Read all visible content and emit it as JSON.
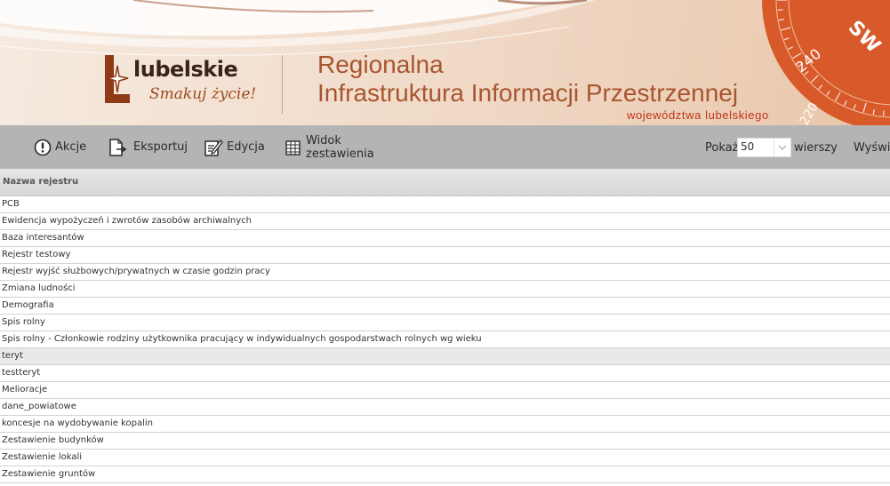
{
  "banner": {
    "logo_word": "lubelskie",
    "logo_slogan": "Smakuj życie!",
    "title_line1": "Regionalna",
    "title_line2": "Infrastruktura Informacji Przestrzennej",
    "subtitle": "województwa lubelskiego",
    "compass_labels": [
      "240",
      "SW",
      "220"
    ]
  },
  "toolbar": {
    "buttons": [
      {
        "label": "Akcje",
        "icon": "exclamation-circle-icon"
      },
      {
        "label": "Eksportuj",
        "icon": "export-document-icon"
      },
      {
        "label": "Edycja",
        "icon": "edit-note-icon"
      },
      {
        "label": "Widok\nzestawienia",
        "icon": "grid-table-icon"
      }
    ],
    "show_label": "Pokaż",
    "rows_per_page": "50",
    "rows_label": "wierszy",
    "view_label": "Wyświe"
  },
  "table": {
    "column_header": "Nazwa rejestru",
    "selected_row": "teryt",
    "rows": [
      "PCB",
      "Ewidencja wypożyczeń i zwrotów zasobów archiwalnych",
      "Baza interesantów",
      "Rejestr testowy",
      "Rejestr wyjść służbowych/prywatnych w czasie godzin pracy",
      "Zmiana ludności",
      "Demografia",
      "Spis rolny",
      "Spis rolny - Członkowie rodziny użytkownika pracujący w indywidualnych gospodarstwach rolnych wg wieku",
      "teryt",
      "testteryt",
      "Melioracje",
      "dane_powiatowe",
      "koncesje na wydobywanie kopalin",
      "Zestawienie budynków",
      "Zestawienie lokali",
      "Zestawienie gruntów"
    ]
  },
  "colors": {
    "accent_orange": "#c0321a",
    "title_brown": "#a8552f",
    "toolbar_gray": "#b4b4b4",
    "compass_orange": "#d85a2a"
  }
}
